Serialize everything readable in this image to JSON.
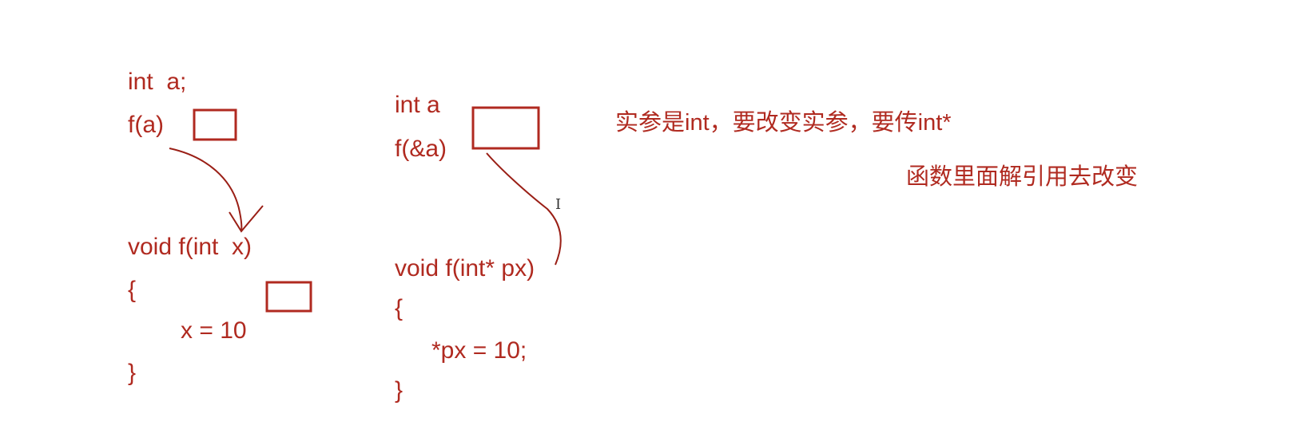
{
  "left_code": {
    "decl": "int  a;",
    "call": "f(a)",
    "sig": "void f(int  x)",
    "open": "{",
    "body": "x = 10",
    "close": "}"
  },
  "middle_code": {
    "decl": "int a",
    "call": "f(&a)",
    "sig": "void f(int* px)",
    "open": "{",
    "body": "*px = 10;",
    "close": "}"
  },
  "notes": {
    "line1": "实参是int，要改变实参，要传int*",
    "line2": "函数里面解引用去改变"
  },
  "cursor_glyph": "I",
  "colors": {
    "ink": "#b02a20",
    "background": "#ffffff"
  }
}
